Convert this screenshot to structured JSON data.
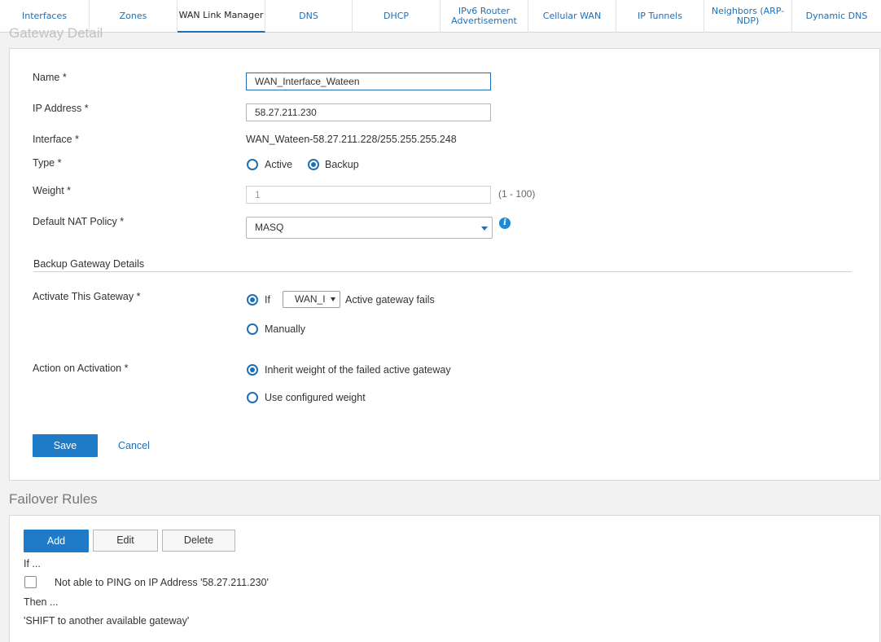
{
  "tabs": [
    {
      "label": "Interfaces"
    },
    {
      "label": "Zones"
    },
    {
      "label": "WAN Link Manager"
    },
    {
      "label": "DNS"
    },
    {
      "label": "DHCP"
    },
    {
      "label": "IPv6 Router Advertisement"
    },
    {
      "label": "Cellular WAN"
    },
    {
      "label": "IP Tunnels"
    },
    {
      "label": "Neighbors (ARP-NDP)"
    },
    {
      "label": "Dynamic DNS"
    }
  ],
  "active_tab": "WAN Link Manager",
  "section_peek": "Gateway Detail",
  "form": {
    "name_label": "Name *",
    "name_value": "WAN_Interface_Wateen",
    "ip_label": "IP Address *",
    "ip_value": "58.27.211.230",
    "interface_label": "Interface *",
    "interface_value": "WAN_Wateen-58.27.211.228/255.255.255.248",
    "type_label": "Type *",
    "type_active": "Active",
    "type_backup": "Backup",
    "type_selected": "Backup",
    "weight_label": "Weight *",
    "weight_value": "1",
    "weight_hint": "(1 - 100)",
    "nat_label": "Default NAT Policy *",
    "nat_value": "MASQ"
  },
  "backup": {
    "heading": "Backup Gateway Details",
    "activate_label": "Activate This Gateway *",
    "activate_if": "If",
    "activate_if_select": "WAN_I",
    "activate_if_suffix": "Active gateway fails",
    "activate_manually": "Manually",
    "activate_selected": "If",
    "action_label": "Action on Activation *",
    "action_inherit": "Inherit weight of the failed active gateway",
    "action_configured": "Use configured weight",
    "action_selected": "Inherit weight of the failed active gateway"
  },
  "buttons": {
    "save": "Save",
    "cancel": "Cancel"
  },
  "failover": {
    "title": "Failover Rules",
    "add": "Add",
    "edit": "Edit",
    "delete": "Delete",
    "if_label": "If ...",
    "rule_prefix": "Not able to",
    "rule_protocol": "PING",
    "rule_mid": "on",
    "rule_target": "IP Address '58.27.211.230'",
    "then_label": "Then ...",
    "then_action": "'SHIFT to another available gateway'"
  },
  "colors": {
    "accent": "#1f7ac8",
    "link": "#1f6fb6",
    "info": "#1f8ad6"
  }
}
